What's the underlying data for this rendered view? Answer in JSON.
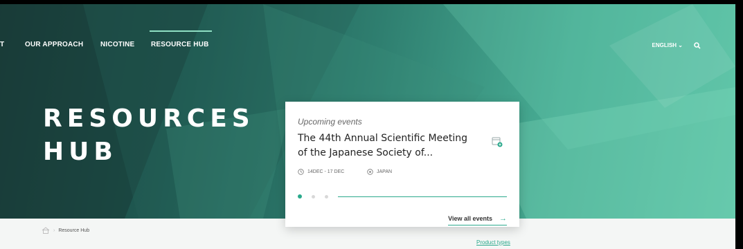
{
  "nav": {
    "items": [
      {
        "label": "T"
      },
      {
        "label": "OUR APPROACH"
      },
      {
        "label": "NICOTINE"
      },
      {
        "label": "RESOURCE HUB",
        "active": true
      }
    ],
    "language": "ENGLISH ⌄",
    "search_icon": "search-icon"
  },
  "hero": {
    "title_line1": "RESOURCES",
    "title_line2": "HUB"
  },
  "event_card": {
    "label": "Upcoming events",
    "title": "The 44th Annual Scientific Meeting of the Japanese Society of...",
    "date": "14DEC - 17 DEC",
    "location": "JAPAN",
    "slide_count": 3,
    "active_slide": 1,
    "view_all": "View all events",
    "arrow": "→"
  },
  "breadcrumb": {
    "home_icon": "home-icon",
    "current": "Resource Hub"
  },
  "product_types_link": "Product types",
  "colors": {
    "accent": "#2aa98c",
    "hero_dark": "#1b3d3a",
    "hero_light": "#5cc3a6"
  }
}
